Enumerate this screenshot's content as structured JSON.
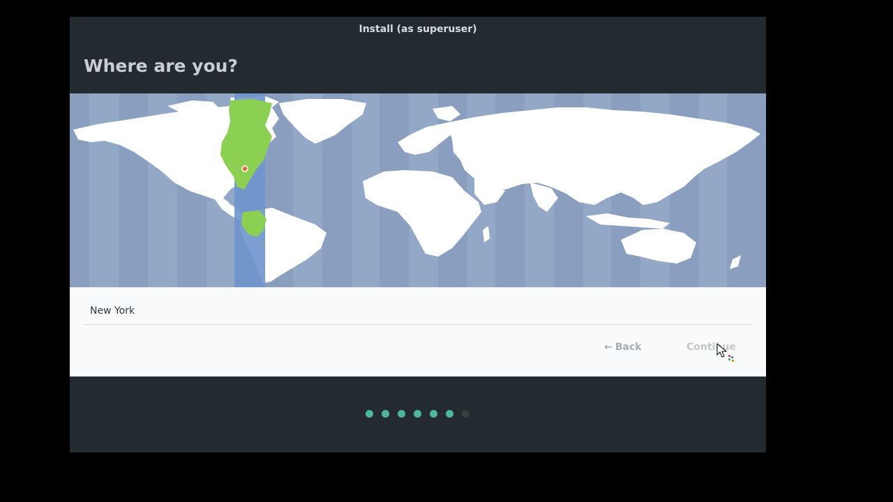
{
  "window": {
    "title": "Install (as superuser)"
  },
  "page": {
    "heading": "Where are you?"
  },
  "location": {
    "value": "New York"
  },
  "buttons": {
    "back_arrow": "←",
    "back_label": "Back",
    "continue_label": "Continue"
  },
  "progress": {
    "total_steps": 7,
    "completed_steps": 6
  },
  "map": {
    "selected_city": "New York",
    "ocean_color": "#8a9fbf",
    "land_color": "#ffffff",
    "timezone_band_color": "#6f93cc",
    "timezone_land_color": "#8bcf53",
    "marker_color": "#e86a3a"
  },
  "colors": {
    "window_bg": "#232b31",
    "panel_bg": "#f8fafb",
    "accent": "#4fb69c"
  }
}
